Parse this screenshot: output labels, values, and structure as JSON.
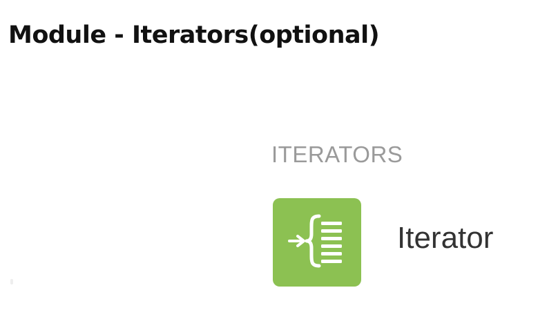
{
  "page": {
    "title": "Module - Iterators(optional)"
  },
  "panel": {
    "section_header": "ITERATORS",
    "items": [
      {
        "label": "Iterator",
        "icon": "iterator-icon",
        "icon_color": "#8cc152"
      }
    ]
  }
}
